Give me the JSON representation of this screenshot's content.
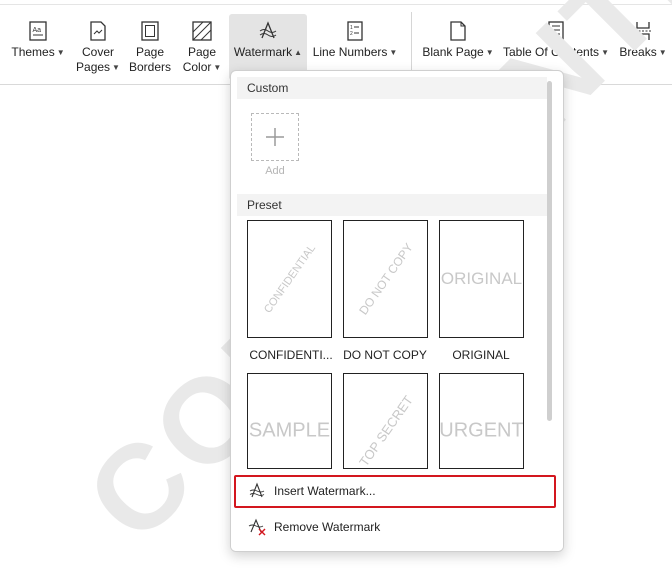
{
  "ribbon": {
    "themes": {
      "label": "Themes"
    },
    "cover_pages": {
      "label1": "Cover",
      "label2": "Pages"
    },
    "page_borders": {
      "label1": "Page",
      "label2": "Borders"
    },
    "page_color": {
      "label1": "Page",
      "label2": "Color"
    },
    "watermark": {
      "label": "Watermark"
    },
    "line_numbers": {
      "label": "Line Numbers"
    },
    "blank_page": {
      "label": "Blank Page"
    },
    "table_of_contents": {
      "label": "Table Of Contents"
    },
    "breaks": {
      "label": "Breaks"
    }
  },
  "document": {
    "background_watermark": "CONFIDENTIAL"
  },
  "menu": {
    "custom_header": "Custom",
    "add_label": "Add",
    "preset_header": "Preset",
    "presets": [
      {
        "label": "CONFIDENTI...",
        "watermark_text": "CONFIDENTIAL"
      },
      {
        "label": "DO NOT COPY",
        "watermark_text": "DO NOT COPY"
      },
      {
        "label": "ORIGINAL",
        "watermark_text": "ORIGINAL"
      },
      {
        "watermark_text": "SAMPLE"
      },
      {
        "watermark_text": "TOP SECRET"
      },
      {
        "watermark_text": "URGENT"
      }
    ],
    "insert_watermark": "Insert Watermark...",
    "remove_watermark": "Remove Watermark"
  },
  "colors": {
    "accent_highlight": "#d3161e",
    "active_button": "#e4e4e4"
  }
}
